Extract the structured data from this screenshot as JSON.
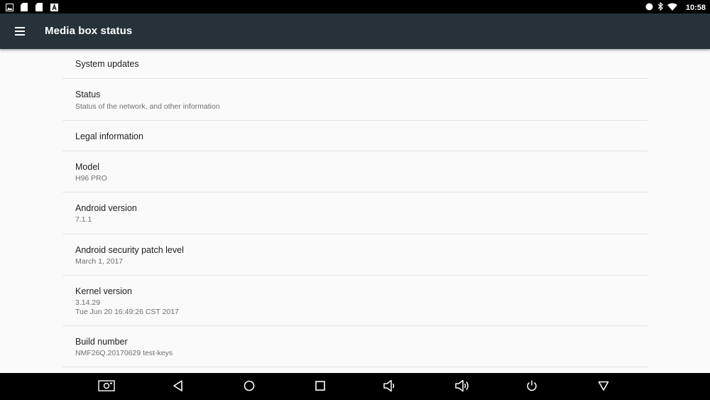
{
  "status_bar": {
    "time": "10:58",
    "left_icons": [
      "image-icon",
      "sd-card-icon",
      "sd-card-icon",
      "text-a-icon"
    ],
    "right_icons": [
      "circle-icon",
      "bluetooth-icon",
      "wifi-icon"
    ]
  },
  "toolbar": {
    "title": "Media box status",
    "menu_icon": "hamburger-menu-icon",
    "background": "#263238"
  },
  "items": [
    {
      "title": "System updates",
      "subtitle": ""
    },
    {
      "title": "Status",
      "subtitle": "Status of the network, and other information"
    },
    {
      "title": "Legal information",
      "subtitle": ""
    },
    {
      "title": "Model",
      "subtitle": "H96 PRO"
    },
    {
      "title": "Android version",
      "subtitle": "7.1.1"
    },
    {
      "title": "Android security patch level",
      "subtitle": "March 1, 2017"
    },
    {
      "title": "Kernel version",
      "subtitle": "3.14.29\nTue Jun 20 16:49:26 CST 2017"
    },
    {
      "title": "Build number",
      "subtitle": "NMF26Q.20170629 test-keys"
    }
  ],
  "nav_bar": {
    "buttons": [
      "screenshot-icon",
      "back-icon",
      "home-icon",
      "recents-icon",
      "volume-down-icon",
      "volume-up-icon",
      "power-icon",
      "hide-bar-icon"
    ]
  }
}
